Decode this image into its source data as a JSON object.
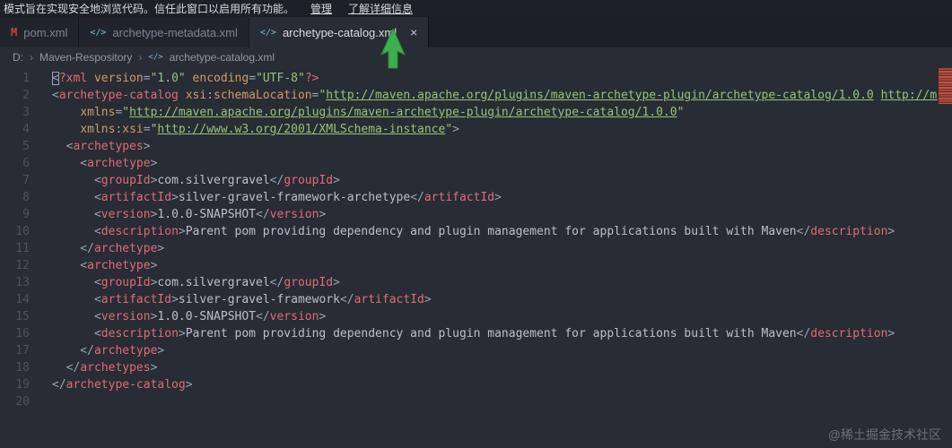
{
  "banner": {
    "message": "模式旨在实现安全地浏览代码。信任此窗口以启用所有功能。",
    "manage_link": "管理",
    "learn_more_link": "了解详细信息"
  },
  "tabs": [
    {
      "label": "pom.xml",
      "icon": "maven-icon",
      "active": false
    },
    {
      "label": "archetype-metadata.xml",
      "icon": "code-icon",
      "active": false
    },
    {
      "label": "archetype-catalog.xml",
      "icon": "code-icon",
      "active": true,
      "close": "×"
    }
  ],
  "breadcrumb": {
    "items": [
      "D:",
      "Maven-Respository",
      "archetype-catalog.xml"
    ]
  },
  "editor": {
    "language": "xml",
    "lines": [
      {
        "n": 1,
        "t": [
          [
            "cursor",
            "<"
          ],
          [
            "tag",
            "?xml"
          ],
          [
            "attr",
            " version"
          ],
          [
            "op",
            "="
          ],
          [
            "str",
            "\"1.0\""
          ],
          [
            "attr",
            " encoding"
          ],
          [
            "op",
            "="
          ],
          [
            "str",
            "\"UTF-8\""
          ],
          [
            "tag",
            "?>"
          ]
        ]
      },
      {
        "n": 2,
        "t": [
          [
            "punct",
            "<"
          ],
          [
            "tag",
            "archetype-catalog"
          ],
          [
            "attr",
            " xsi:schemaLocation"
          ],
          [
            "op",
            "="
          ],
          [
            "str",
            "\""
          ],
          [
            "link",
            "http://maven.apache.org/plugins/maven-archetype-plugin/archetype-catalog/1.0.0"
          ],
          [
            "str",
            " "
          ],
          [
            "link",
            "http://ma"
          ]
        ]
      },
      {
        "n": 3,
        "t": [
          [
            "punct",
            "    "
          ],
          [
            "attr",
            "xmlns"
          ],
          [
            "op",
            "="
          ],
          [
            "str",
            "\""
          ],
          [
            "link",
            "http://maven.apache.org/plugins/maven-archetype-plugin/archetype-catalog/1.0.0"
          ],
          [
            "str",
            "\""
          ]
        ]
      },
      {
        "n": 4,
        "t": [
          [
            "punct",
            "    "
          ],
          [
            "attr",
            "xmlns:xsi"
          ],
          [
            "op",
            "="
          ],
          [
            "str",
            "\""
          ],
          [
            "link",
            "http://www.w3.org/2001/XMLSchema-instance"
          ],
          [
            "str",
            "\""
          ],
          [
            "punct",
            ">"
          ]
        ]
      },
      {
        "n": 5,
        "t": [
          [
            "punct",
            "  <"
          ],
          [
            "tag",
            "archetypes"
          ],
          [
            "punct",
            ">"
          ]
        ]
      },
      {
        "n": 6,
        "t": [
          [
            "punct",
            "    <"
          ],
          [
            "tag",
            "archetype"
          ],
          [
            "punct",
            ">"
          ]
        ]
      },
      {
        "n": 7,
        "t": [
          [
            "punct",
            "      <"
          ],
          [
            "tag",
            "groupId"
          ],
          [
            "punct",
            ">"
          ],
          [
            "txt",
            "com.silvergravel"
          ],
          [
            "punct",
            "</"
          ],
          [
            "tag",
            "groupId"
          ],
          [
            "punct",
            ">"
          ]
        ]
      },
      {
        "n": 8,
        "t": [
          [
            "punct",
            "      <"
          ],
          [
            "tag",
            "artifactId"
          ],
          [
            "punct",
            ">"
          ],
          [
            "txt",
            "silver-gravel-framework-archetype"
          ],
          [
            "punct",
            "</"
          ],
          [
            "tag",
            "artifactId"
          ],
          [
            "punct",
            ">"
          ]
        ]
      },
      {
        "n": 9,
        "t": [
          [
            "punct",
            "      <"
          ],
          [
            "tag",
            "version"
          ],
          [
            "punct",
            ">"
          ],
          [
            "txt",
            "1.0.0-SNAPSHOT"
          ],
          [
            "punct",
            "</"
          ],
          [
            "tag",
            "version"
          ],
          [
            "punct",
            ">"
          ]
        ]
      },
      {
        "n": 10,
        "t": [
          [
            "punct",
            "      <"
          ],
          [
            "tag",
            "description"
          ],
          [
            "punct",
            ">"
          ],
          [
            "txt",
            "Parent pom providing dependency and plugin management for applications built with Maven"
          ],
          [
            "punct",
            "</"
          ],
          [
            "tag",
            "description"
          ],
          [
            "punct",
            ">"
          ]
        ]
      },
      {
        "n": 11,
        "t": [
          [
            "punct",
            "    </"
          ],
          [
            "tag",
            "archetype"
          ],
          [
            "punct",
            ">"
          ]
        ]
      },
      {
        "n": 12,
        "t": [
          [
            "punct",
            "    <"
          ],
          [
            "tag",
            "archetype"
          ],
          [
            "punct",
            ">"
          ]
        ]
      },
      {
        "n": 13,
        "t": [
          [
            "punct",
            "      <"
          ],
          [
            "tag",
            "groupId"
          ],
          [
            "punct",
            ">"
          ],
          [
            "txt",
            "com.silvergravel"
          ],
          [
            "punct",
            "</"
          ],
          [
            "tag",
            "groupId"
          ],
          [
            "punct",
            ">"
          ]
        ]
      },
      {
        "n": 14,
        "t": [
          [
            "punct",
            "      <"
          ],
          [
            "tag",
            "artifactId"
          ],
          [
            "punct",
            ">"
          ],
          [
            "txt",
            "silver-gravel-framework"
          ],
          [
            "punct",
            "</"
          ],
          [
            "tag",
            "artifactId"
          ],
          [
            "punct",
            ">"
          ]
        ]
      },
      {
        "n": 15,
        "t": [
          [
            "punct",
            "      <"
          ],
          [
            "tag",
            "version"
          ],
          [
            "punct",
            ">"
          ],
          [
            "txt",
            "1.0.0-SNAPSHOT"
          ],
          [
            "punct",
            "</"
          ],
          [
            "tag",
            "version"
          ],
          [
            "punct",
            ">"
          ]
        ]
      },
      {
        "n": 16,
        "t": [
          [
            "punct",
            "      <"
          ],
          [
            "tag",
            "description"
          ],
          [
            "punct",
            ">"
          ],
          [
            "txt",
            "Parent pom providing dependency and plugin management for applications built with Maven"
          ],
          [
            "punct",
            "</"
          ],
          [
            "tag",
            "description"
          ],
          [
            "punct",
            ">"
          ]
        ]
      },
      {
        "n": 17,
        "t": [
          [
            "punct",
            "    </"
          ],
          [
            "tag",
            "archetype"
          ],
          [
            "punct",
            ">"
          ]
        ]
      },
      {
        "n": 18,
        "t": [
          [
            "punct",
            "  </"
          ],
          [
            "tag",
            "archetypes"
          ],
          [
            "punct",
            ">"
          ]
        ]
      },
      {
        "n": 19,
        "t": [
          [
            "punct",
            "</"
          ],
          [
            "tag",
            "archetype-catalog"
          ],
          [
            "punct",
            ">"
          ]
        ]
      },
      {
        "n": 20,
        "t": []
      }
    ]
  },
  "watermark": "@稀土掘金技术社区",
  "colors": {
    "editor_bg": "#282c34",
    "tabbar_bg": "#1b1e24",
    "tag": "#e06c75",
    "attribute": "#d19a66",
    "string": "#98c379",
    "text": "#b9c0cb",
    "line_number": "#4b5263",
    "cursor_arrow": "#3fae4c"
  }
}
